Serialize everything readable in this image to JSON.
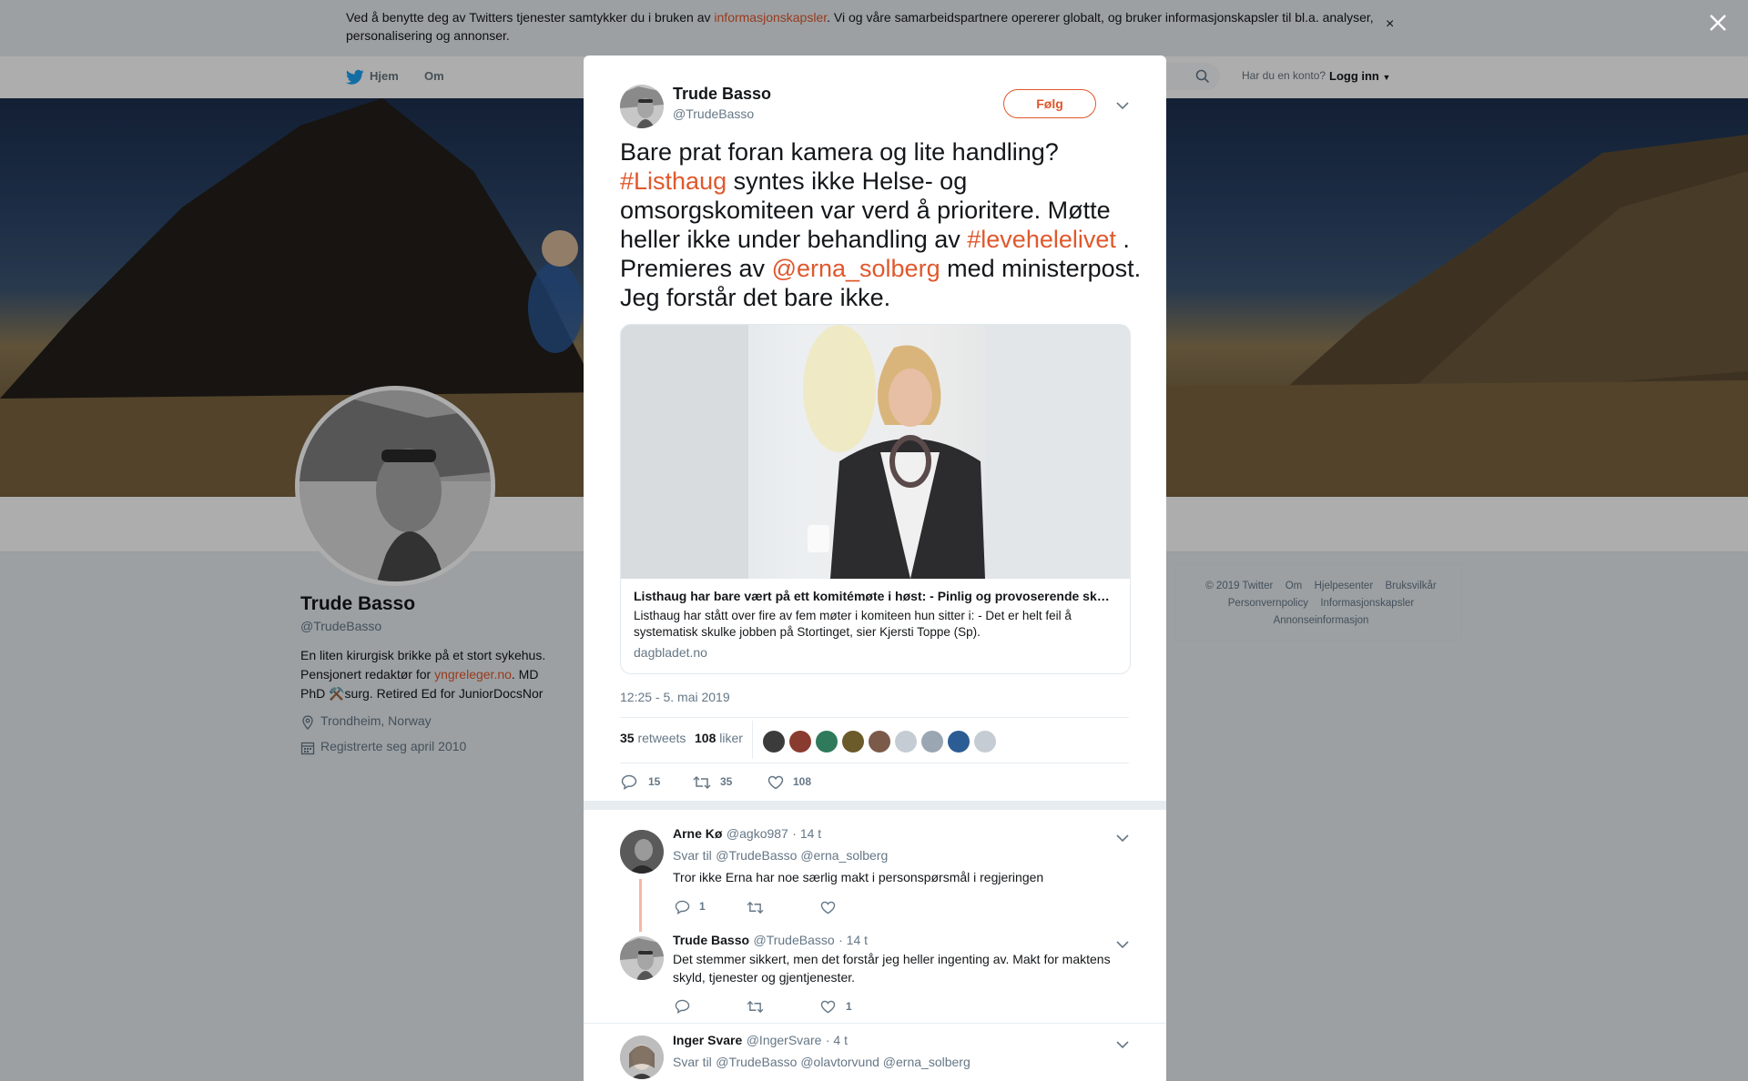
{
  "cookie": {
    "text_before": "Ved å benytte deg av Twitters tjenester samtykker du i bruken av ",
    "link": "informasjonskapsler",
    "text_after": ". Vi og våre samarbeidspartnere opererer globalt, og bruker informasjonskapsler til bl.a. analyser, personalisering og annonser.",
    "close": "×"
  },
  "nav": {
    "home": "Hjem",
    "about": "Om",
    "login_question": "Har du en konto?",
    "login": "Logg inn"
  },
  "profile": {
    "name": "Trude Basso",
    "handle": "@TrudeBasso",
    "bio_before": "En liten kirurgisk brikke på et stort sykehus. Pensjonert redaktør for ",
    "bio_link": "yngreleger.no",
    "bio_after": ". MD PhD ⚒️surg. Retired Ed for JuniorDocsNor",
    "location": "Trondheim, Norway",
    "joined": "Registrerte seg april 2010"
  },
  "footer": {
    "items": [
      "© 2019 Twitter",
      "Om",
      "Hjelpesenter",
      "Bruksvilkår",
      "Personvernpolicy",
      "Informasjonskapsler",
      "Annonseinformasjon"
    ]
  },
  "modal": {
    "name": "Trude Basso",
    "handle": "@TrudeBasso",
    "follow": "Følg",
    "tweet": {
      "t1": "Bare prat foran kamera og lite handling? ",
      "h1": "#Listhaug",
      "t2": " syntes ikke Helse- og omsorgskomiteen var verd å prioritere. Møtte heller ikke under behandling av ",
      "h2": "#levehelelivet",
      "t3": " . Premieres av ",
      "h3": "@erna_solberg",
      "t4": " med ministerpost. Jeg forstår det bare ikke."
    },
    "card": {
      "title": "Listhaug har bare vært på ett komitémøte i høst: - Pinlig og provoserende skulking",
      "description": "Listhaug har stått over fire av fem møter i komiteen hun sitter i: - Det er helt feil å systematisk skulke jobben på Stortinget, sier Kjersti Toppe (Sp).",
      "domain": "dagbladet.no"
    },
    "timestamp": "12:25 - 5. mai 2019",
    "retweets_count": "35",
    "retweets_label": "retweets",
    "likes_count": "108",
    "likes_label": "liker",
    "actions": {
      "replies": "15",
      "retweets": "35",
      "likes": "108"
    }
  },
  "replies": [
    {
      "name": "Arne Kø",
      "handle": "@agko987",
      "time": "· 14 t",
      "svar": "Svar til",
      "mentions": "@TrudeBasso @erna_solberg",
      "text": "Tror ikke Erna har noe særlig makt i personspørsmål i regjeringen",
      "replies": "1"
    },
    {
      "name": "Trude Basso",
      "handle": "@TrudeBasso",
      "time": "· 14 t",
      "text": "Det stemmer sikkert, men det forstår jeg heller ingenting av. Makt for maktens skyld, tjenester og gjentjenester.",
      "likes": "1"
    },
    {
      "name": "Inger Svare",
      "handle": "@IngerSvare",
      "time": "· 4 t",
      "svar": "Svar til",
      "mentions": "@TrudeBasso @olavtorvund @erna_solberg"
    }
  ],
  "colors": {
    "accent": "#e0582c",
    "twitter_blue": "#1da1f2",
    "muted": "#657786"
  }
}
